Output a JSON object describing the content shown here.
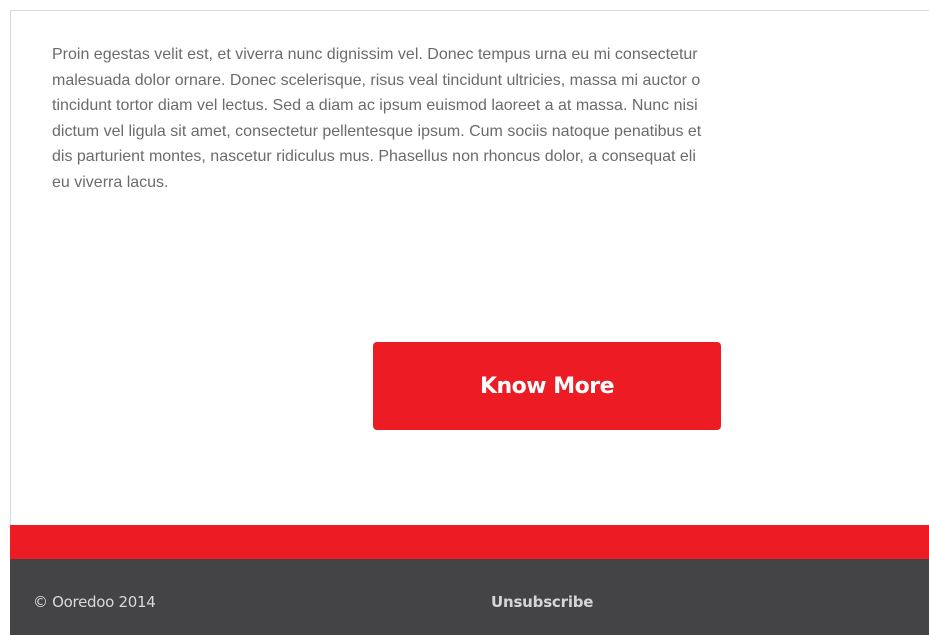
{
  "email": {
    "body_lines": [
      "Proin egestas velit est, et viverra nunc dignissim vel. Donec tempus urna eu mi consectetur",
      "malesuada dolor ornare. Donec scelerisque, risus veal tincidunt ultricies, massa mi auctor o",
      "tincidunt tortor diam vel lectus. Sed a diam ac ipsum euismod laoreet a at massa. Nunc nisi",
      "dictum vel ligula sit amet, consectetur pellentesque ipsum. Cum sociis natoque penatibus et",
      "dis parturient montes, nascetur ridiculus mus. Phasellus non rhoncus dolor, a consequat eli",
      "eu viverra lacus."
    ],
    "cta_label": "Know More"
  },
  "footer": {
    "copyright": "© Ooredoo 2014",
    "unsubscribe_label": "Unsubscribe"
  },
  "colors": {
    "brand_red": "#ed1c24",
    "footer_bg": "#444446",
    "body_text": "#6b6b6b"
  }
}
